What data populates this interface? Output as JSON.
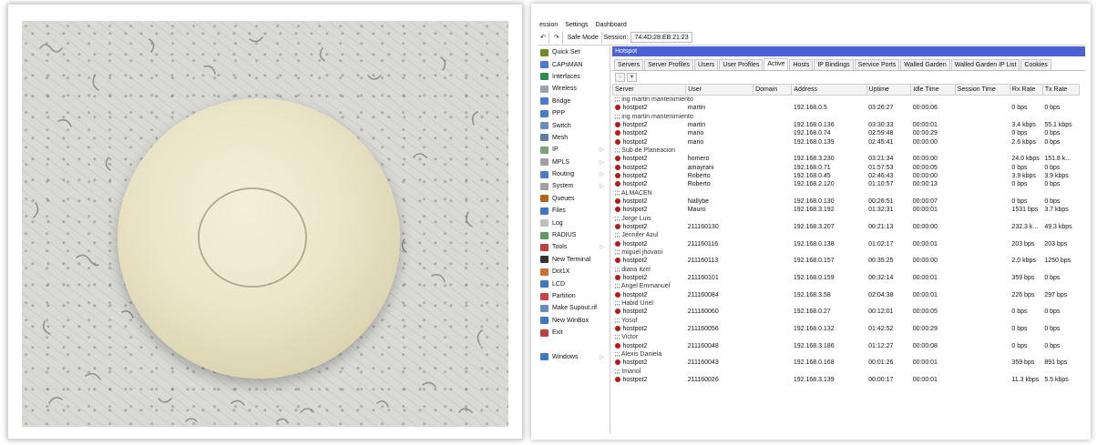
{
  "menu": [
    "ession",
    "Settings",
    "Dashboard"
  ],
  "toolbar": {
    "undo_icon": "undo-icon",
    "redo_icon": "redo-icon",
    "safe_mode": "Safe Mode",
    "session_label": "Session:",
    "session_value": "74:4D:28:EB:21:23"
  },
  "sidebar": [
    {
      "label": "Quick Set",
      "icon": "wand-icon",
      "color": "#6b8e23"
    },
    {
      "label": "CAPsMAN",
      "icon": "capsman-icon",
      "color": "#4a7bd0"
    },
    {
      "label": "Interfaces",
      "icon": "interfaces-icon",
      "color": "#2e8b57"
    },
    {
      "label": "Wireless",
      "icon": "wireless-icon",
      "color": "#9aa4b1"
    },
    {
      "label": "Bridge",
      "icon": "bridge-icon",
      "color": "#4a7bd0"
    },
    {
      "label": "PPP",
      "icon": "ppp-icon",
      "color": "#4a7bd0"
    },
    {
      "label": "Switch",
      "icon": "switch-icon",
      "color": "#6c8ebf"
    },
    {
      "label": "Mesh",
      "icon": "mesh-icon",
      "color": "#5b7fa6"
    },
    {
      "label": "IP",
      "icon": "ip-icon",
      "color": "#7aa37a",
      "arrow": true
    },
    {
      "label": "MPLS",
      "icon": "mpls-icon",
      "color": "#a0a0a0",
      "arrow": true
    },
    {
      "label": "Routing",
      "icon": "routing-icon",
      "color": "#4a7bd0",
      "arrow": true
    },
    {
      "label": "System",
      "icon": "system-icon",
      "color": "#a0a0a0",
      "arrow": true
    },
    {
      "label": "Queues",
      "icon": "queues-icon",
      "color": "#b5651d"
    },
    {
      "label": "Files",
      "icon": "files-icon",
      "color": "#3c78c8"
    },
    {
      "label": "Log",
      "icon": "log-icon",
      "color": "#bfbfbf"
    },
    {
      "label": "RADIUS",
      "icon": "radius-icon",
      "color": "#5b9b5b"
    },
    {
      "label": "Tools",
      "icon": "tools-icon",
      "color": "#c04040",
      "arrow": true
    },
    {
      "label": "New Terminal",
      "icon": "terminal-icon",
      "color": "#333333"
    },
    {
      "label": "Dot1X",
      "icon": "dot1x-icon",
      "color": "#d07030"
    },
    {
      "label": "LCD",
      "icon": "lcd-icon",
      "color": "#3c78c8"
    },
    {
      "label": "Partition",
      "icon": "partition-icon",
      "color": "#d04040"
    },
    {
      "label": "Make Supout.rif",
      "icon": "supout-icon",
      "color": "#6c8ebf"
    },
    {
      "label": "New WinBox",
      "icon": "winbox-icon",
      "color": "#3c78c8"
    },
    {
      "label": "Exit",
      "icon": "exit-icon",
      "color": "#c04040"
    },
    {
      "label": "",
      "icon": "",
      "color": "transparent"
    },
    {
      "label": "Windows",
      "icon": "windows-icon",
      "color": "#3c78c8",
      "arrow": true
    }
  ],
  "window": {
    "title": "Hotspot"
  },
  "tabs": [
    "Servers",
    "Server Profiles",
    "Users",
    "User Profiles",
    "Active",
    "Hosts",
    "IP Bindings",
    "Service Ports",
    "Walled Garden",
    "Walled Garden IP List",
    "Cookies"
  ],
  "active_tab": "Active",
  "columns": [
    "Server",
    "User",
    "Domain",
    "Address",
    "Uptime",
    "Idle Time",
    "Session Time",
    "Rx Rate",
    "Tx Rate"
  ],
  "rows": [
    {
      "group": ";;; ing martin mantenimiento"
    },
    {
      "server": "hostpot2",
      "user": "martin",
      "domain": "",
      "address": "192.168.0.5",
      "uptime": "03:26:27",
      "idle": "00:00:06",
      "session": "",
      "rx": "0 bps",
      "tx": "0 bps"
    },
    {
      "group": ";;; ing martin mantenimiento"
    },
    {
      "server": "hostpot2",
      "user": "martin",
      "domain": "",
      "address": "192.168.0.136",
      "uptime": "03:30:33",
      "idle": "00:00:01",
      "session": "",
      "rx": "3.4 kbps",
      "tx": "55.1 kbps"
    },
    {
      "server": "hostpot2",
      "user": "mario",
      "domain": "",
      "address": "192.168.0.74",
      "uptime": "02:59:48",
      "idle": "00:00:29",
      "session": "",
      "rx": "0 bps",
      "tx": "0 bps"
    },
    {
      "server": "hostpot2",
      "user": "mario",
      "domain": "",
      "address": "192.168.0.139",
      "uptime": "02:45:41",
      "idle": "00:00:00",
      "session": "",
      "rx": "2.6 kbps",
      "tx": "0 bps"
    },
    {
      "group": ";;; Sub de Planeacion"
    },
    {
      "server": "hostpot2",
      "user": "homero",
      "domain": "",
      "address": "192.168.3.230",
      "uptime": "03:21:34",
      "idle": "00:00:00",
      "session": "",
      "rx": "24.0 kbps",
      "tx": "151.8 k..."
    },
    {
      "server": "hostpot2",
      "user": "amayrani",
      "domain": "",
      "address": "192.168.0.71",
      "uptime": "01:57:53",
      "idle": "00:00:05",
      "session": "",
      "rx": "0 bps",
      "tx": "0 bps"
    },
    {
      "server": "hostpot2",
      "user": "Roberto",
      "domain": "",
      "address": "192.168.0.45",
      "uptime": "02:46:43",
      "idle": "00:00:00",
      "session": "",
      "rx": "3.9 kbps",
      "tx": "3.9 kbps"
    },
    {
      "server": "hostpot2",
      "user": "Roberto",
      "domain": "",
      "address": "192.168.2.120",
      "uptime": "01:10:57",
      "idle": "00:00:13",
      "session": "",
      "rx": "0 bps",
      "tx": "0 bps"
    },
    {
      "group": ";;; ALMACEN"
    },
    {
      "server": "hostpot2",
      "user": "Nallybe",
      "domain": "",
      "address": "192.168.0.130",
      "uptime": "00:26:51",
      "idle": "00:00:07",
      "session": "",
      "rx": "0 bps",
      "tx": "0 bps"
    },
    {
      "server": "hostpot2",
      "user": "Mauro",
      "domain": "",
      "address": "192.168.3.192",
      "uptime": "01:32:31",
      "idle": "00:00:01",
      "session": "",
      "rx": "1531 bps",
      "tx": "3.7 kbps"
    },
    {
      "group": ";;; Jorge Luis"
    },
    {
      "server": "hostpot2",
      "user": "211160130",
      "domain": "",
      "address": "192.168.3.207",
      "uptime": "00:21:13",
      "idle": "00:00:00",
      "session": "",
      "rx": "232.3 k...",
      "tx": "49.3 kbps"
    },
    {
      "group": ";;; Jennifer Azul"
    },
    {
      "server": "hostpot2",
      "user": "211160116",
      "domain": "",
      "address": "192.168.0.138",
      "uptime": "01:02:17",
      "idle": "00:00:01",
      "session": "",
      "rx": "203 bps",
      "tx": "203 bps"
    },
    {
      "group": ";;; miguel jhovani"
    },
    {
      "server": "hostpot2",
      "user": "211160113",
      "domain": "",
      "address": "192.168.0.157",
      "uptime": "00:35:25",
      "idle": "00:00:00",
      "session": "",
      "rx": "2.0 kbps",
      "tx": "1250 bps"
    },
    {
      "group": ";;; diana itzel"
    },
    {
      "server": "hostpot2",
      "user": "211160101",
      "domain": "",
      "address": "192.168.0.159",
      "uptime": "00:32:14",
      "idle": "00:00:01",
      "session": "",
      "rx": "359 bps",
      "tx": "0 bps"
    },
    {
      "group": ";;; Angel Emmanuel"
    },
    {
      "server": "hostpot2",
      "user": "211160084",
      "domain": "",
      "address": "192.168.3.58",
      "uptime": "02:04:38",
      "idle": "00:00:01",
      "session": "",
      "rx": "226 bps",
      "tx": "297 bps"
    },
    {
      "group": ";;; Habid Uriel"
    },
    {
      "server": "hostpot2",
      "user": "211160060",
      "domain": "",
      "address": "192.168.0.27",
      "uptime": "00:12:01",
      "idle": "00:00:05",
      "session": "",
      "rx": "0 bps",
      "tx": "0 bps"
    },
    {
      "group": ";;; Yosuf"
    },
    {
      "server": "hostpot2",
      "user": "211160056",
      "domain": "",
      "address": "192.168.0.132",
      "uptime": "01:42:52",
      "idle": "00:00:29",
      "session": "",
      "rx": "0 bps",
      "tx": "0 bps"
    },
    {
      "group": ";;; Victor"
    },
    {
      "server": "hostpot2",
      "user": "211160048",
      "domain": "",
      "address": "192.168.3.186",
      "uptime": "01:12:27",
      "idle": "00:00:08",
      "session": "",
      "rx": "0 bps",
      "tx": "0 bps"
    },
    {
      "group": ";;; Alexis Daniela"
    },
    {
      "server": "hostpot2",
      "user": "211160043",
      "domain": "",
      "address": "192.168.0.168",
      "uptime": "00:01:26",
      "idle": "00:00:01",
      "session": "",
      "rx": "359 bps",
      "tx": "891 bps"
    },
    {
      "group": ";;; Imanol"
    },
    {
      "server": "hostpot2",
      "user": "211160026",
      "domain": "",
      "address": "192.168.3.139",
      "uptime": "00:00:17",
      "idle": "00:00:01",
      "session": "",
      "rx": "11.3 kbps",
      "tx": "5.5 kbps"
    }
  ]
}
